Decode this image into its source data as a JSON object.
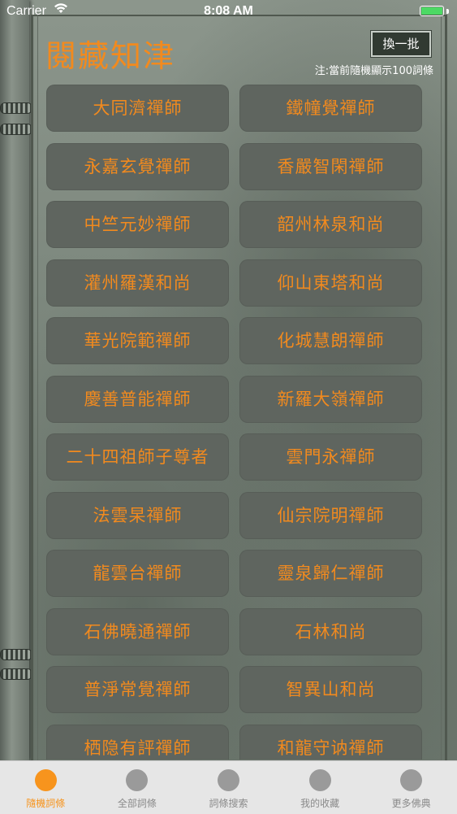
{
  "status": {
    "carrier": "Carrier",
    "wifi_icon": "wifi-icon",
    "time": "8:08 AM",
    "battery_level": 1.0
  },
  "header": {
    "title": "閱藏知津",
    "refresh_label": "換一批",
    "note": "注:當前隨機顯示100詞條"
  },
  "colors": {
    "accent": "#f28a1e",
    "tab_active": "#f7941d",
    "button_bg": "#5f655f"
  },
  "entries": [
    "大同濟禪師",
    "鐵幢覺禪師",
    "永嘉玄覺禪師",
    "香嚴智閑禪師",
    "中竺元妙禪師",
    "韶州林泉和尚",
    "灌州羅漢和尚",
    "仰山東塔和尚",
    "華光院範禪師",
    "化城慧朗禪師",
    "慶善普能禪師",
    "新羅大嶺禪師",
    "二十四祖師子尊者",
    "雲門永禪師",
    "法雲杲禪師",
    "仙宗院明禪師",
    "龍雲台禪師",
    "靈泉歸仁禪師",
    "石佛曉通禪師",
    "石林和尚",
    "普淨常覺禪師",
    "智異山和尚",
    "栖隐有評禪師",
    "和龍守讷禪師"
  ],
  "tabs": [
    {
      "label": "隨機詞條",
      "icon": "circle-icon",
      "active": true
    },
    {
      "label": "全部詞條",
      "icon": "circle-icon",
      "active": false
    },
    {
      "label": "詞條搜索",
      "icon": "circle-icon",
      "active": false
    },
    {
      "label": "我的收藏",
      "icon": "circle-icon",
      "active": false
    },
    {
      "label": "更多佛典",
      "icon": "circle-icon",
      "active": false
    }
  ]
}
